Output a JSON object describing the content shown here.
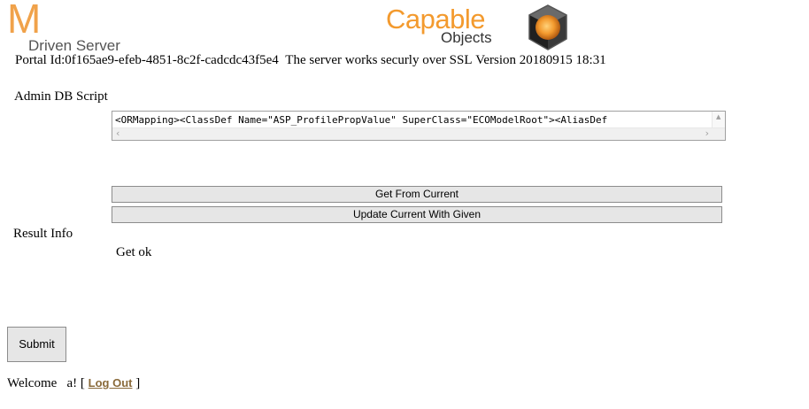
{
  "logos": {
    "mdriven_letter": "M",
    "mdriven_text": "Driven Server",
    "capable_word": "Capable",
    "objects_word": "Objects"
  },
  "portal": {
    "portal_id": "Portal Id:0f165ae9-efeb-4851-8c2f-cadcdc43f5e4",
    "ssl_status": "The server works securly over SSL",
    "version": "Version 20180915 18:31"
  },
  "admin_script": {
    "label": "Admin DB Script",
    "value": "<ORMapping><ClassDef Name=\"ASP_ProfilePropValue\" SuperClass=\"ECOModelRoot\"><AliasDef"
  },
  "buttons": {
    "get_from_current": "Get From Current",
    "update_current": "Update Current With Given",
    "submit": "Submit"
  },
  "result": {
    "label": "Result Info",
    "value": "Get ok"
  },
  "welcome": {
    "prefix": "Welcome",
    "user": "a! [",
    "logout": "Log Out",
    "suffix": "]"
  },
  "colors": {
    "mdriven_orange": "#f0a24a",
    "capable_orange": "#f39a2e",
    "logout_link": "#8a6a3a"
  }
}
